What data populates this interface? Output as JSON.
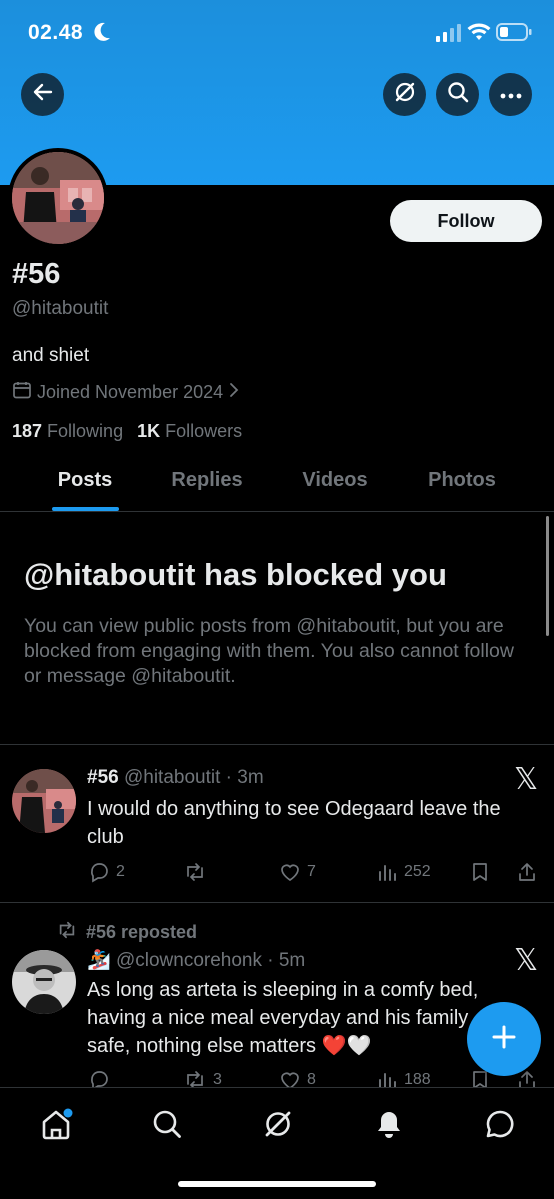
{
  "status_bar": {
    "time": "02.48"
  },
  "header_actions": [
    "back-arrow-icon",
    "grok-icon",
    "search-icon",
    "more-icon"
  ],
  "profile": {
    "follow_label": "Follow",
    "name": "#56",
    "handle": "@hitaboutit",
    "bio": "and shiet",
    "joined": "Joined November 2024",
    "following_count": "187",
    "following_label": "Following",
    "followers_count": "1K",
    "followers_label": "Followers"
  },
  "tabs": [
    {
      "label": "Posts",
      "active": true
    },
    {
      "label": "Replies"
    },
    {
      "label": "Videos"
    },
    {
      "label": "Photos"
    }
  ],
  "blocked": {
    "title": "@hitaboutit has blocked you",
    "message": "You can view public posts from @hitaboutit, but you are blocked from engaging with them. You also cannot follow or message @hitaboutit."
  },
  "tweets": [
    {
      "name": "#56",
      "meta": "@hitaboutit · 3m",
      "text": "I would do anything to see Odegaard leave the club",
      "replies": "2",
      "reposts": "",
      "likes": "7",
      "views": "252"
    },
    {
      "repost_label": "#56 reposted",
      "name_emoji": "🏂",
      "meta": "@clowncorehonk · 5m",
      "text": "As long as arteta is sleeping in a comfy bed, having a nice meal everyday and his family safe, nothing else matters ❤️🤍",
      "replies": "",
      "reposts": "3",
      "likes": "8",
      "views": "188"
    }
  ],
  "colors": {
    "accent": "#1d9bf0",
    "background": "#000000",
    "muted": "#71767b",
    "text": "#e7e9ea"
  }
}
